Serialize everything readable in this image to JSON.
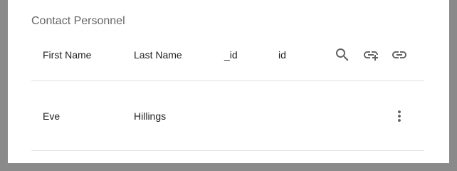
{
  "section": {
    "title": "Contact Personnel"
  },
  "table": {
    "columns": [
      "First Name",
      "Last Name",
      "_id",
      "id"
    ],
    "header_actions": [
      "search-icon",
      "link-add-icon",
      "link-icon"
    ],
    "rows": [
      {
        "first_name": "Eve",
        "last_name": "Hillings",
        "_id": "",
        "id": "",
        "row_action": "more-vert-icon"
      }
    ]
  },
  "colors": {
    "overlay": "#8a8a8a",
    "surface": "#ffffff",
    "title_text": "#666666",
    "body_text": "#212121",
    "icon": "#616161",
    "divider": "#e0e0e0"
  }
}
